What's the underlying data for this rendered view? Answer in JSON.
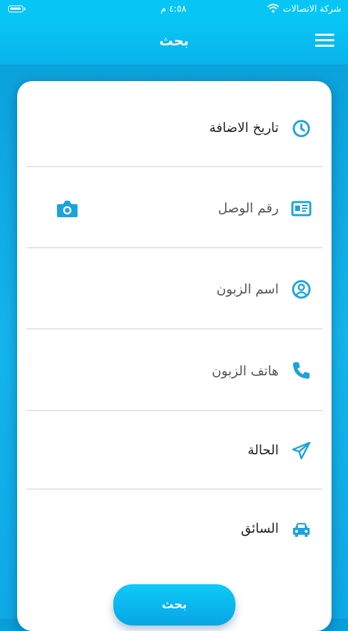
{
  "status_bar": {
    "carrier": "شركة الاتصالات",
    "time": "٤:٥٨ م"
  },
  "nav": {
    "title": "بحث",
    "menu_icon": "hamburger-menu-icon"
  },
  "form": {
    "fields": [
      {
        "label": "تاريخ الاضافة",
        "icon": "clock-icon"
      },
      {
        "label": "رقم الوصل",
        "icon": "id-card-icon",
        "action_icon": "camera-icon"
      },
      {
        "label": "اسم الزبون",
        "icon": "user-circle-icon"
      },
      {
        "label": "هاتف الزبون",
        "icon": "phone-icon"
      },
      {
        "label": "الحالة",
        "icon": "paper-plane-icon"
      },
      {
        "label": "السائق",
        "icon": "car-icon"
      }
    ]
  },
  "search_button": {
    "label": "بحث"
  },
  "colors": {
    "accent": "#1aa3de",
    "header": "#07c6f6",
    "background": "#14b4ec"
  }
}
